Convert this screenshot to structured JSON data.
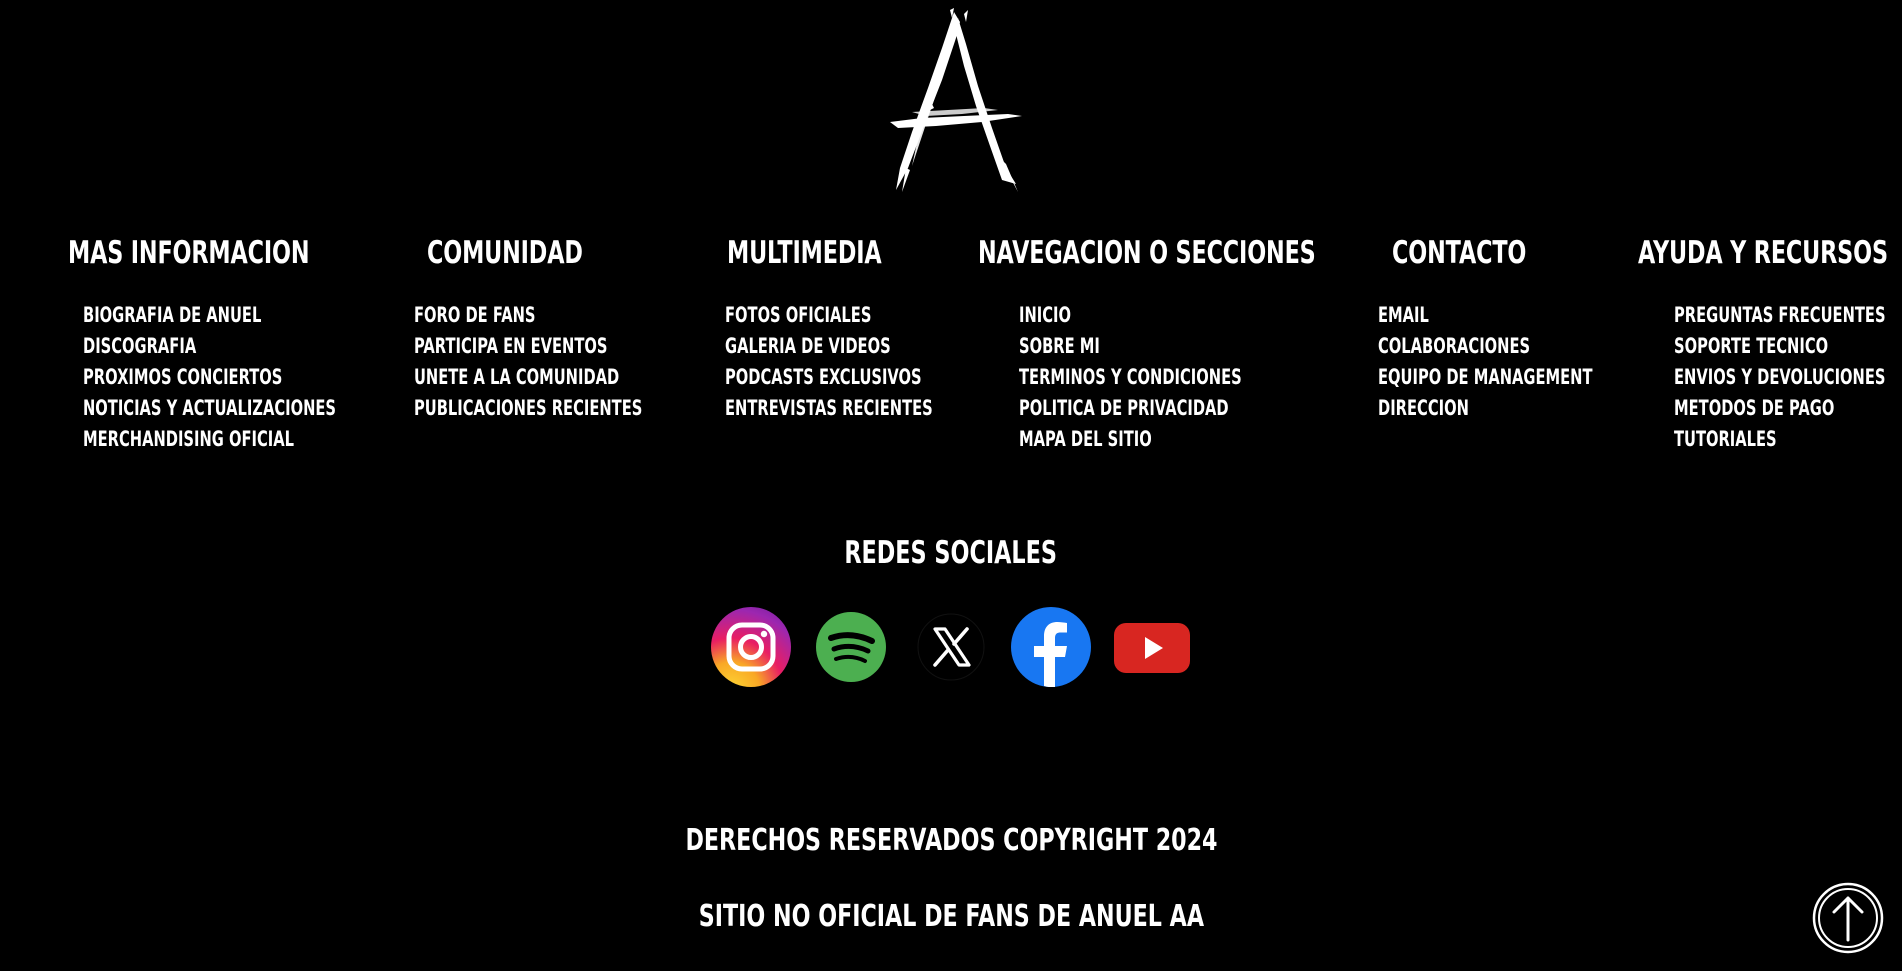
{
  "logo": {
    "icon": "anuel-aa-logo-icon"
  },
  "columns": [
    {
      "title": "MAS INFORMACION",
      "links": [
        "BIOGRAFIA DE ANUEL",
        "DISCOGRAFIA",
        "PROXIMOS CONCIERTOS",
        "NOTICIAS Y ACTUALIZACIONES",
        "MERCHANDISING OFICIAL"
      ]
    },
    {
      "title": "COMUNIDAD",
      "links": [
        "FORO DE FANS",
        "PARTICIPA EN EVENTOS",
        "UNETE A LA COMUNIDAD",
        "PUBLICACIONES RECIENTES"
      ]
    },
    {
      "title": "MULTIMEDIA",
      "links": [
        "FOTOS OFICIALES",
        "GALERIA DE VIDEOS",
        "PODCASTS EXCLUSIVOS",
        "ENTREVISTAS RECIENTES"
      ]
    },
    {
      "title": "NAVEGACION O SECCIONES",
      "links": [
        "INICIO",
        "SOBRE MI",
        "TERMINOS Y CONDICIONES",
        "POLITICA DE PRIVACIDAD",
        "MAPA DEL SITIO"
      ]
    },
    {
      "title": "CONTACTO",
      "links": [
        "EMAIL",
        "COLABORACIONES",
        "EQUIPO DE MANAGEMENT",
        "DIRECCION"
      ]
    },
    {
      "title": "AYUDA Y RECURSOS",
      "links": [
        "PREGUNTAS FRECUENTES",
        "SOPORTE TECNICO",
        "ENVIOS Y DEVOLUCIONES",
        "METODOS DE PAGO",
        "TUTORIALES"
      ]
    }
  ],
  "social": {
    "title": "REDES SOCIALES",
    "icons": [
      "instagram-icon",
      "spotify-icon",
      "x-twitter-icon",
      "facebook-icon",
      "youtube-icon"
    ]
  },
  "footer": {
    "copyright": "DERECHOS RESERVADOS COPYRIGHT 2024",
    "unofficial": "SITIO NO OFICIAL DE FANS DE ANUEL AA"
  },
  "back_to_top": {
    "icon": "arrow-up-circle-icon"
  },
  "colors": {
    "background": "#000000",
    "text": "#ffffff",
    "instagram": "#d62976",
    "spotify": "#4caf50",
    "facebook": "#1877f2",
    "youtube": "#d82621"
  }
}
